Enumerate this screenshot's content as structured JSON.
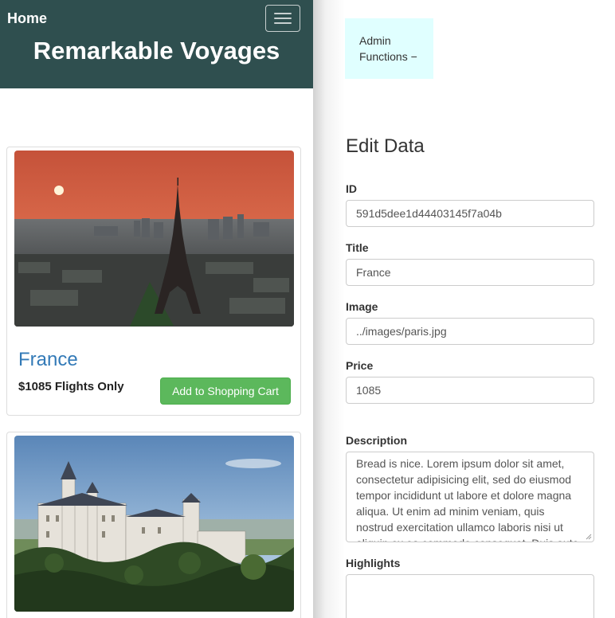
{
  "nav": {
    "home": "Home",
    "site_title": "Remarkable Voyages"
  },
  "cards": [
    {
      "title": "France",
      "price": "$1085 Flights Only",
      "button": "Add to Shopping Cart"
    }
  ],
  "admin": {
    "toggle": "Admin Functions −"
  },
  "edit": {
    "heading": "Edit Data",
    "id_label": "ID",
    "id_value": "591d5dee1d44403145f7a04b",
    "title_label": "Title",
    "title_value": "France",
    "image_label": "Image",
    "image_value": "../images/paris.jpg",
    "price_label": "Price",
    "price_value": "1085",
    "description_label": "Description",
    "description_value": "Bread is nice. Lorem ipsum dolor sit amet, consectetur adipisicing elit, sed do eiusmod tempor incididunt ut labore et dolore magna aliqua. Ut enim ad minim veniam, quis nostrud exercitation ullamco laboris nisi ut aliquip ex ea commodo consequat. Duis aute",
    "highlights_label": "Highlights",
    "highlights_value": ""
  },
  "colors": {
    "navbar": "#2f4f4f",
    "link": "#337ab7",
    "success": "#5cb85c",
    "admin_bg": "#e0ffff"
  }
}
